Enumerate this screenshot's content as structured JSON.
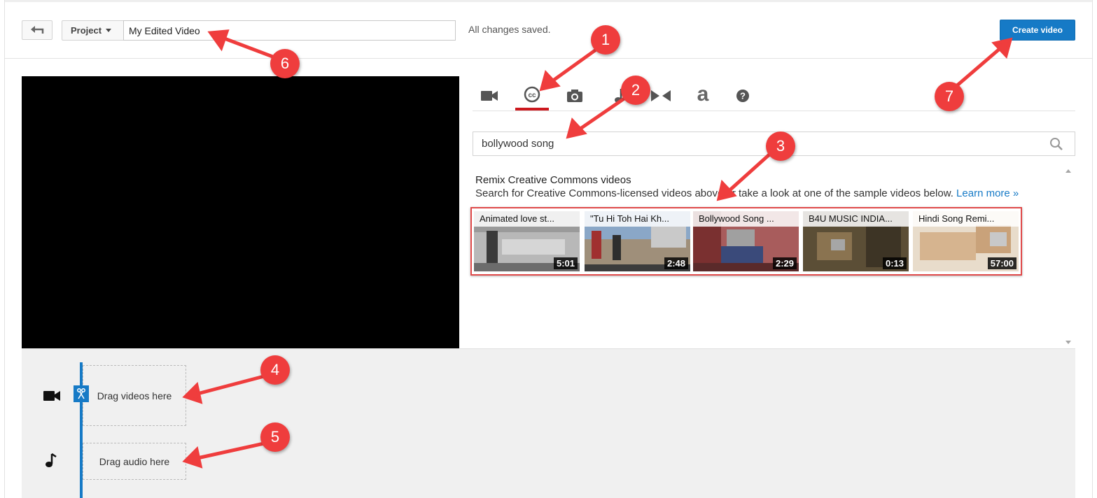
{
  "header": {
    "project_label": "Project",
    "title_value": "My Edited Video",
    "save_status": "All changes saved.",
    "create_label": "Create video"
  },
  "tabs": [
    {
      "icon": "video-camera-icon",
      "active": false
    },
    {
      "icon": "creative-commons-icon",
      "active": true
    },
    {
      "icon": "camera-icon",
      "active": false
    },
    {
      "icon": "music-note-icon",
      "active": false
    },
    {
      "icon": "transitions-icon",
      "active": false
    },
    {
      "icon": "text-a-icon",
      "label": "a",
      "active": false
    },
    {
      "icon": "help-icon",
      "active": false
    }
  ],
  "search": {
    "value": "bollywood song"
  },
  "results": {
    "heading": "Remix Creative Commons videos",
    "description": "Search for Creative Commons-licensed videos above or take a look at one of the sample videos below. ",
    "learn_more": "Learn more »",
    "videos": [
      {
        "title": "Animated love st...",
        "duration": "5:01"
      },
      {
        "title": "\"Tu Hi Toh Hai Kh...",
        "duration": "2:48"
      },
      {
        "title": "Bollywood Song ...",
        "duration": "2:29"
      },
      {
        "title": "B4U MUSIC INDIA...",
        "duration": "0:13"
      },
      {
        "title": "Hindi Song Remi...",
        "duration": "57:00"
      }
    ]
  },
  "timeline": {
    "video_drop": "Drag videos here",
    "audio_drop": "Drag audio here"
  },
  "annotations": [
    "1",
    "2",
    "3",
    "4",
    "5",
    "6",
    "7"
  ],
  "colors": {
    "accent": "#167ac6",
    "active_tab": "#cc181e",
    "annotation": "#ef3d3d"
  }
}
